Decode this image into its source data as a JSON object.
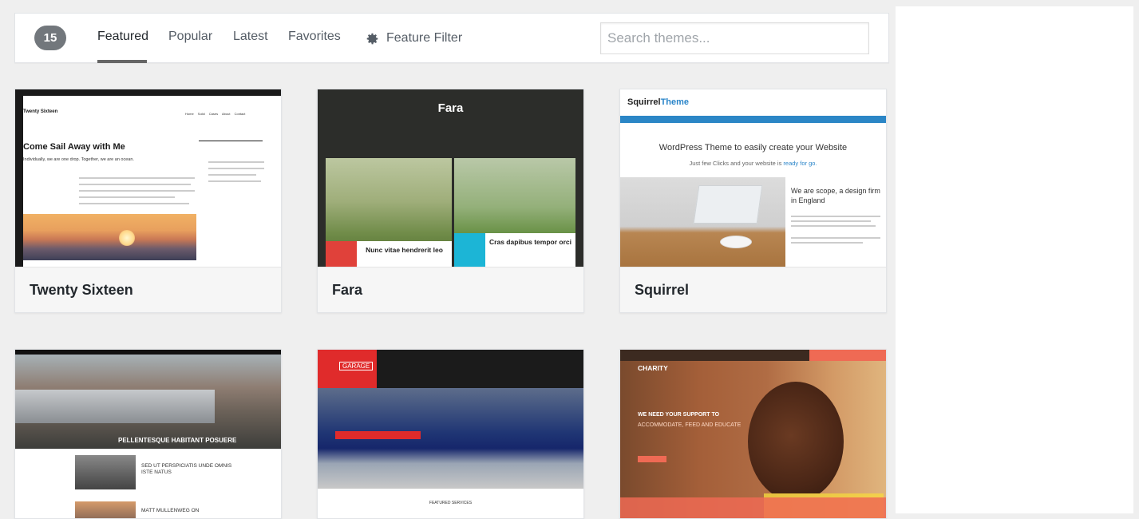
{
  "filter_bar": {
    "count": "15",
    "tabs": [
      {
        "label": "Featured",
        "active": true
      },
      {
        "label": "Popular",
        "active": false
      },
      {
        "label": "Latest",
        "active": false
      },
      {
        "label": "Favorites",
        "active": false
      }
    ],
    "feature_filter_label": "Feature Filter",
    "feature_filter_icon": "gear-icon",
    "search_placeholder": "Search themes..."
  },
  "themes": [
    {
      "name": "Twenty Sixteen",
      "preview": {
        "site_title": "Twenty Sixteen",
        "nav": "Home  Solid Cases  About  Contact",
        "headline": "Come Sail Away with Me",
        "sub": "Individually, we are one drop. Together, we are an ocean."
      }
    },
    {
      "name": "Fara",
      "preview": {
        "title": "Fara",
        "caption_1": "Nunc vitae hendrerit leo",
        "caption_2": "Cras dapibus tempor orci"
      }
    },
    {
      "name": "Squirrel",
      "preview": {
        "logo_main": "Squirrel",
        "logo_accent": "Theme",
        "headline": "WordPress Theme to easily create your Website",
        "sub_prefix": "Just few Clicks and your website is ",
        "sub_link": "ready for go.",
        "side_heading": "We are scope, a design firm in England"
      }
    },
    {
      "name": "",
      "preview": {
        "banner": "PELLENTESQUE HABITANT POSUERE",
        "post_1": "SED UT PERSPICIATIS UNDE OMNIS ISTE NATUS",
        "post_2": "MATT MULLENWEG ON"
      }
    },
    {
      "name": "",
      "preview": {
        "logo": "GARAGE",
        "footer": "FEATURED SERVICES"
      }
    },
    {
      "name": "",
      "preview": {
        "logo": "CHARITY",
        "line_1": "WE NEED YOUR SUPPORT TO",
        "line_2": "ACCOMMODATE, FEED AND EDUCATE"
      }
    }
  ],
  "colors": {
    "badge": "#72777c",
    "accent_blue": "#2a85c9",
    "accent_red": "#e02b2b"
  }
}
